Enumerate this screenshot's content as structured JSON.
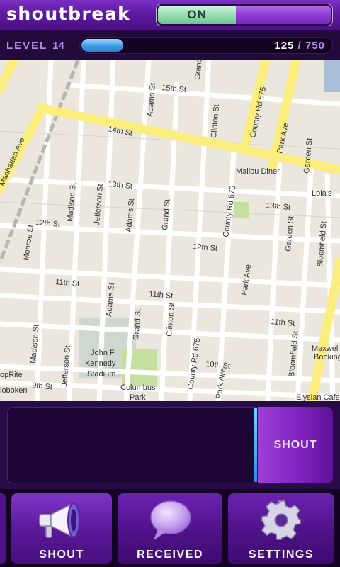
{
  "header": {
    "app_title": "shoutbreak",
    "toggle_label": "ON"
  },
  "level": {
    "label": "LEVEL",
    "number": "14",
    "xp_current": "125",
    "xp_separator": "/",
    "xp_total": "750",
    "progress_fraction": 0.167
  },
  "map": {
    "streets": {
      "st_15": "15th St",
      "st_14": "14th St",
      "st_13a": "13th St",
      "st_13b": "13th St",
      "st_12a": "12th St",
      "st_12b": "12th St",
      "st_11a": "11th St",
      "st_11b": "11th St",
      "st_11c": "11th St",
      "st_10": "10th St",
      "st_9": "9th St",
      "manhattan": "Manhattan Ave",
      "madison_a": "Madison St",
      "madison_b": "Madison St",
      "jefferson_a": "Jefferson St",
      "jefferson_b": "Jefferson St",
      "adams_a": "Adams St",
      "adams_b": "Adams St",
      "adams_c": "Adams St",
      "grand_a": "Grand St",
      "grand_b": "Grand St",
      "grand_c": "Grand St",
      "clinton_a": "Clinton St",
      "clinton_b": "Clinton St",
      "county_a": "County Rd 675",
      "county_b": "County Rd 675",
      "county_c": "County Rd 675",
      "park_a": "Park Ave",
      "park_b": "Park Ave",
      "park_c": "Park Ave",
      "garden_a": "Garden St",
      "garden_b": "Garden St",
      "bloomfield_a": "Bloomfield St",
      "bloomfield_b": "Bloomfield St",
      "monroe": "Monroe St"
    },
    "places": {
      "malibu": "Malibu Diner",
      "lolas": "Lola's",
      "stadium_1": "John F",
      "stadium_2": "Kennedy",
      "stadium_3": "Stadium",
      "columbus_1": "Columbus",
      "columbus_2": "Park",
      "maxwell_1": "Maxwell's",
      "maxwell_2": "Booking",
      "elysian": "Elysian Cafe",
      "shoprite_1": "opRite",
      "shoprite_2": "loboken"
    }
  },
  "composer": {
    "placeholder": "",
    "send_label": "SHOUT"
  },
  "nav": {
    "items": [
      {
        "label": "SHOUT",
        "icon": "megaphone-icon"
      },
      {
        "label": "RECEIVED",
        "icon": "speech-bubble-icon"
      },
      {
        "label": "SETTINGS",
        "icon": "gear-icon"
      }
    ]
  },
  "colors": {
    "header": "#5d1a9e",
    "toggle_on": "#8fd9ac",
    "progress": "#3f9be6",
    "nav": "#4f1288",
    "road_major": "#fbed7e",
    "map_bg": "#e6e2da"
  }
}
